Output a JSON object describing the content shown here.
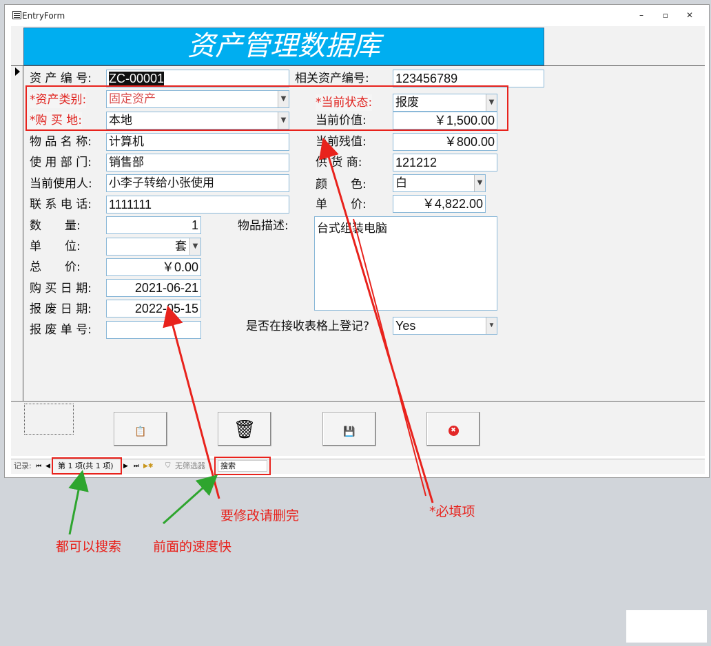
{
  "window": {
    "title": "EntryForm",
    "min": "–",
    "max": "▫",
    "close": "✕"
  },
  "header": {
    "title": "资产管理数据库"
  },
  "labels": {
    "asset_no": "资 产 编 号:",
    "related_asset_no": "相关资产编号:",
    "asset_category": "*资产类别:",
    "current_status": "*当前状态:",
    "purchase_place": "*购 买 地:",
    "current_value": "当前价值:",
    "item_name": "物 品 名 称:",
    "residual_value": "当前残值:",
    "department": "使 用 部 门:",
    "supplier": "供 货 商:",
    "current_user": "当前使用人:",
    "color": "颜　　色:",
    "phone": "联 系 电 话:",
    "unit_price": "单　　价:",
    "quantity": "数　　量:",
    "description": "物品描述:",
    "unit": "单　　位:",
    "total_price": "总　　价:",
    "purchase_date": "购 买 日 期:",
    "scrap_date": "报 废 日 期:",
    "scrap_no": "报 废 单 号:",
    "registered": "是否在接收表格上登记?"
  },
  "values": {
    "asset_no": "ZC-00001",
    "related_asset_no": "123456789",
    "asset_category": "固定资产",
    "current_status": "报废",
    "purchase_place": "本地",
    "current_value": "￥1,500.00",
    "item_name": "计算机",
    "residual_value": "￥800.00",
    "department": "销售部",
    "supplier": "121212",
    "current_user": "小李子转给小张使用",
    "color": "白",
    "phone": "1111111",
    "unit_price": "￥4,822.00",
    "quantity": "1",
    "description": "台式组装电脑",
    "unit": "套",
    "total_price": "￥0.00",
    "purchase_date": "2021-06-21",
    "scrap_date": "2022-05-15",
    "scrap_no": "",
    "registered": "Yes"
  },
  "buttons": [
    {
      "name": "paste-button",
      "icon": "clipboard-icon",
      "glyph": "📋"
    },
    {
      "name": "delete-button",
      "icon": "trash-icon",
      "glyph": "🗑"
    },
    {
      "name": "save-button",
      "icon": "floppy-icon",
      "glyph": "💾"
    },
    {
      "name": "close-button",
      "icon": "close-circle-icon",
      "glyph": "✖"
    }
  ],
  "navbar": {
    "record_label": "记录:",
    "first": "⏮",
    "prev": "◀",
    "position": "第 1 项(共 1 项)",
    "next": "▶",
    "last": "⏭",
    "new": "▶✱",
    "filter": "无筛选器",
    "search": "搜索"
  },
  "annotations": {
    "required": "*必填项",
    "delete_to_modify": "要修改请删完",
    "faster": "前面的速度快",
    "both_searchable": "都可以搜索"
  },
  "colors": {
    "header": "#00aef0",
    "required_text": "#e0231f",
    "annotation_red": "#e8221c",
    "annotation_green": "#2ea52e"
  }
}
